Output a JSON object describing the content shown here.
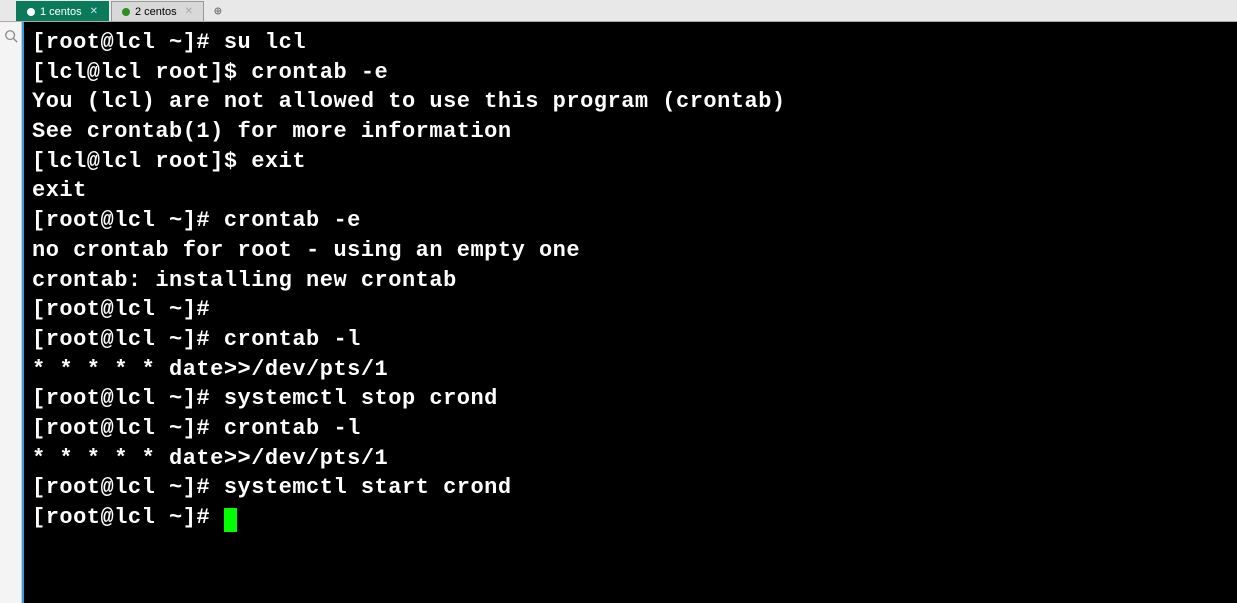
{
  "tabs": [
    {
      "label": "1 centos",
      "active": true
    },
    {
      "label": "2 centos",
      "active": false
    }
  ],
  "terminal": {
    "lines": [
      "[root@lcl ~]# su lcl",
      "[lcl@lcl root]$ crontab -e",
      "You (lcl) are not allowed to use this program (crontab)",
      "See crontab(1) for more information",
      "[lcl@lcl root]$ exit",
      "exit",
      "[root@lcl ~]# crontab -e",
      "no crontab for root - using an empty one",
      "crontab: installing new crontab",
      "[root@lcl ~]# ",
      "[root@lcl ~]# crontab -l",
      "* * * * * date>>/dev/pts/1",
      "[root@lcl ~]# systemctl stop crond",
      "[root@lcl ~]# crontab -l",
      "* * * * * date>>/dev/pts/1",
      "[root@lcl ~]# systemctl start crond",
      "[root@lcl ~]# "
    ]
  }
}
